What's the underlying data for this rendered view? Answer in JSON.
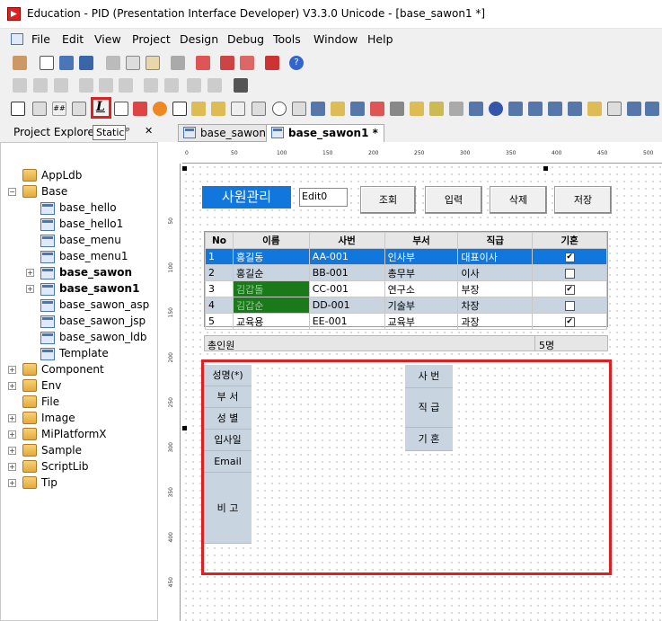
{
  "window": {
    "title": "Education - PID (Presentation Interface Developer) V3.3.0 Unicode - [base_sawon1 *]"
  },
  "menu": [
    "File",
    "Edit",
    "View",
    "Project",
    "Design",
    "Debug",
    "Tools",
    "Window",
    "Help"
  ],
  "toolbar": {
    "static_tool_label": "L",
    "tooltip": "Static"
  },
  "project_explorer": {
    "title": "Project Explorer",
    "tree": [
      {
        "label": "AppLdb",
        "bold": false
      },
      {
        "label": "Base",
        "bold": false
      },
      {
        "label": "base_hello",
        "bold": false
      },
      {
        "label": "base_hello1",
        "bold": false
      },
      {
        "label": "base_menu",
        "bold": false
      },
      {
        "label": "base_menu1",
        "bold": false
      },
      {
        "label": "base_sawon",
        "bold": true
      },
      {
        "label": "base_sawon1",
        "bold": true
      },
      {
        "label": "base_sawon_asp",
        "bold": false
      },
      {
        "label": "base_sawon_jsp",
        "bold": false
      },
      {
        "label": "base_sawon_ldb",
        "bold": false
      },
      {
        "label": "Template",
        "bold": false
      },
      {
        "label": "Component",
        "bold": false
      },
      {
        "label": "Env",
        "bold": false
      },
      {
        "label": "File",
        "bold": false
      },
      {
        "label": "Image",
        "bold": false
      },
      {
        "label": "MiPlatformX",
        "bold": false
      },
      {
        "label": "Sample",
        "bold": false
      },
      {
        "label": "ScriptLib",
        "bold": false
      },
      {
        "label": "Tip",
        "bold": false
      }
    ]
  },
  "tabs": [
    {
      "label": "base_sawon *",
      "active": false
    },
    {
      "label": "base_sawon1 *",
      "active": true
    }
  ],
  "ruler": {
    "top": [
      "0",
      "50",
      "100",
      "150",
      "200",
      "250",
      "300",
      "350",
      "400",
      "450",
      "500"
    ],
    "left": [
      "50",
      "100",
      "150",
      "200",
      "250",
      "300",
      "350",
      "400",
      "450"
    ]
  },
  "form": {
    "title": "사원관리",
    "edit_value": "Edit0",
    "buttons": [
      "조회",
      "입력",
      "삭제",
      "저장"
    ],
    "grid": {
      "columns": [
        "No",
        "이름",
        "사번",
        "부서",
        "직급",
        "기혼"
      ],
      "rows": [
        {
          "no": "1",
          "name": "홍길동",
          "id": "AA-001",
          "dept": "인사부",
          "rank": "대표이사",
          "married": true
        },
        {
          "no": "2",
          "name": "홍길순",
          "id": "BB-001",
          "dept": "총무부",
          "rank": "이사",
          "married": false
        },
        {
          "no": "3",
          "name": "김갑돌",
          "id": "CC-001",
          "dept": "연구소",
          "rank": "부장",
          "married": true
        },
        {
          "no": "4",
          "name": "김갑순",
          "id": "DD-001",
          "dept": "기술부",
          "rank": "차장",
          "married": false
        },
        {
          "no": "5",
          "name": "교육용",
          "id": "EE-001",
          "dept": "교육부",
          "rank": "과장",
          "married": true
        }
      ],
      "footer_label": "총인원",
      "footer_count": "5명"
    },
    "detail_labels_left": [
      "성명(*)",
      "부 서",
      "성 별",
      "입사일",
      "Email",
      "비 고"
    ],
    "detail_labels_right": [
      "사 번",
      "직 급",
      "기 혼"
    ]
  },
  "colors": {
    "accent": "#1177dd",
    "highlight": "#e02020",
    "alt_row": "#c8d4e0",
    "green_cell": "#1a7a1a"
  }
}
